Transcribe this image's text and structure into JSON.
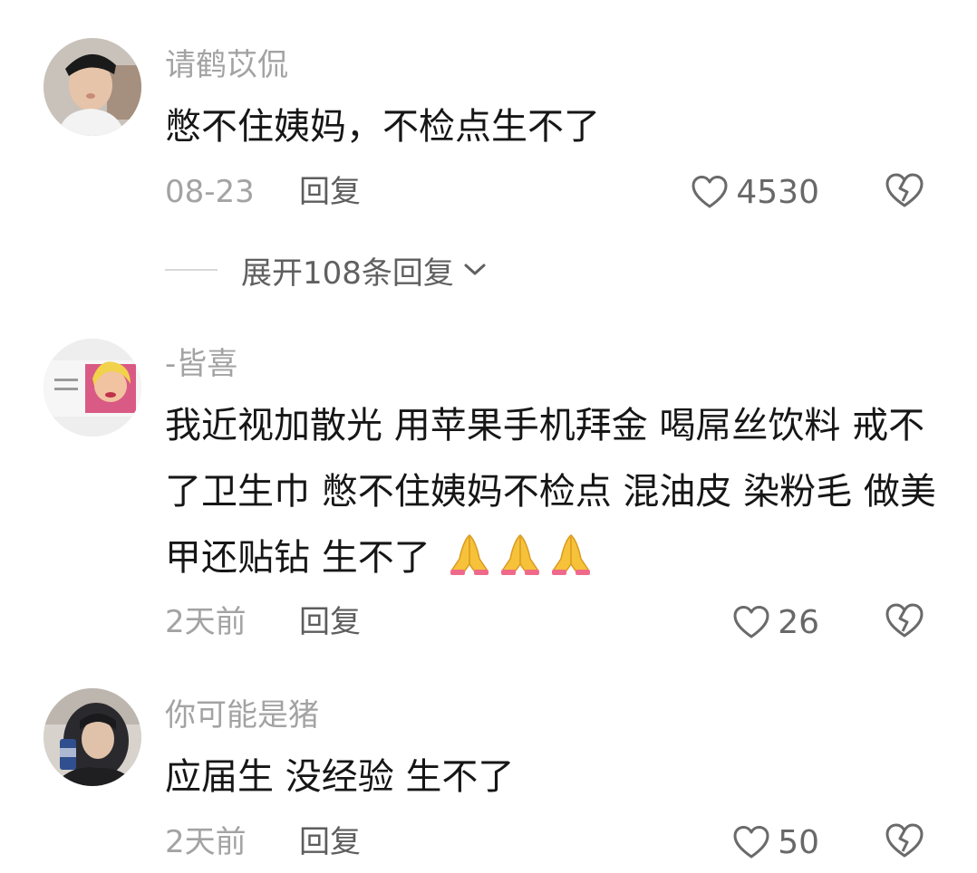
{
  "comments": [
    {
      "username": "请鹤苡侃",
      "text": "憋不住姨妈，不检点生不了",
      "time": "08-23",
      "reply_label": "回复",
      "likes": "4530",
      "expand_label": "展开108条回复"
    },
    {
      "username": "-皆喜",
      "text": "我近视加散光 用苹果手机拜金 喝屌丝饮料 戒不了卫生巾 憋不住姨妈不检点 混油皮 染粉毛 做美甲还贴钻 生不了",
      "emoji": [
        "folded-hands",
        "folded-hands",
        "folded-hands"
      ],
      "time": "2天前",
      "reply_label": "回复",
      "likes": "26"
    },
    {
      "username": "你可能是猪",
      "text": "应届生 没经验 生不了",
      "time": "2天前",
      "reply_label": "回复",
      "likes": "50"
    }
  ],
  "colors": {
    "username": "#a3a3a3",
    "text": "#161616",
    "meta": "#a3a3a3",
    "reply": "#5d5d5d",
    "icon": "#6a6a6a"
  },
  "icons": {
    "like": "heart-outline-icon",
    "dislike": "broken-heart-icon",
    "expand": "chevron-down-icon",
    "emoji": "folded-hands-emoji"
  }
}
